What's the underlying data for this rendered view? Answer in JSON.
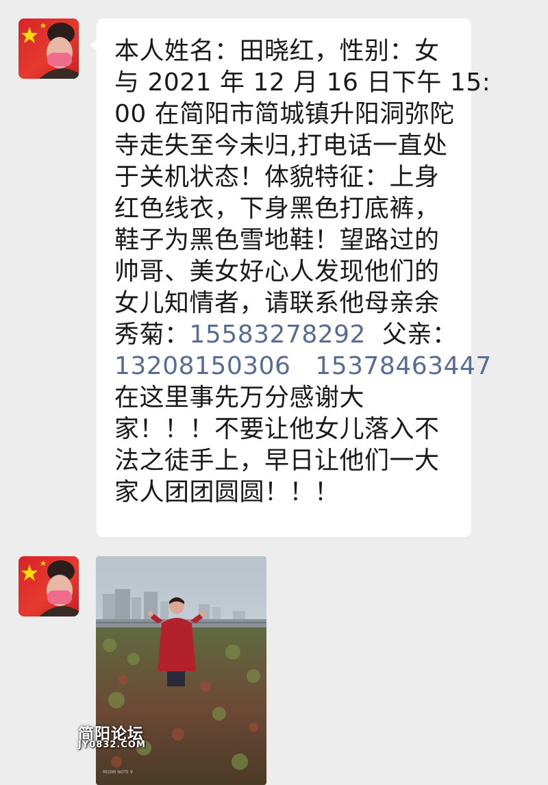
{
  "message": {
    "lines": [
      [
        {
          "t": "本人姓名：田晓红，性别：女"
        }
      ],
      [
        {
          "t": "与 2021 年 12 月 16 日下午 15:"
        }
      ],
      [
        {
          "t": "00 在简阳市简城镇升阳洞弥陀"
        }
      ],
      [
        {
          "t": "寺走失至今未归,打电话一直处"
        }
      ],
      [
        {
          "t": "于关机状态！体貌特征：上身"
        }
      ],
      [
        {
          "t": "红色线衣，下身黑色打底裤，"
        }
      ],
      [
        {
          "t": "鞋子为黑色雪地鞋！望路过的"
        }
      ],
      [
        {
          "t": "帅哥、美女好心人发现他们的"
        }
      ],
      [
        {
          "t": "女儿知情者，请联系他母亲余"
        }
      ],
      [
        {
          "t": "秀菊："
        },
        {
          "t": "15583278292",
          "phone": true
        },
        {
          "t": "  父亲："
        }
      ],
      [
        {
          "t": "13208150306",
          "phone": true
        },
        {
          "t": "   "
        },
        {
          "t": "15378463447",
          "phone": true
        }
      ],
      [
        {
          "t": "在这里事先万分感谢大"
        }
      ],
      [
        {
          "t": "家！！！不要让他女儿落入不"
        }
      ],
      [
        {
          "t": "法之徒手上，早日让他们一大"
        }
      ],
      [
        {
          "t": "家人团团圆圆！！！"
        }
      ]
    ]
  },
  "watermark": {
    "title": "简阳论坛",
    "subtitle": "JY0832.COM"
  },
  "photo": {
    "camera_mark": "REDMI NOTE 9"
  },
  "colors": {
    "link": "#576b95",
    "chat_background": "#ededed",
    "bubble": "#ffffff"
  },
  "icons": {
    "avatar": "user-avatar-flag-masked-woman",
    "photo": "photo-woman-in-red-in-garden"
  }
}
